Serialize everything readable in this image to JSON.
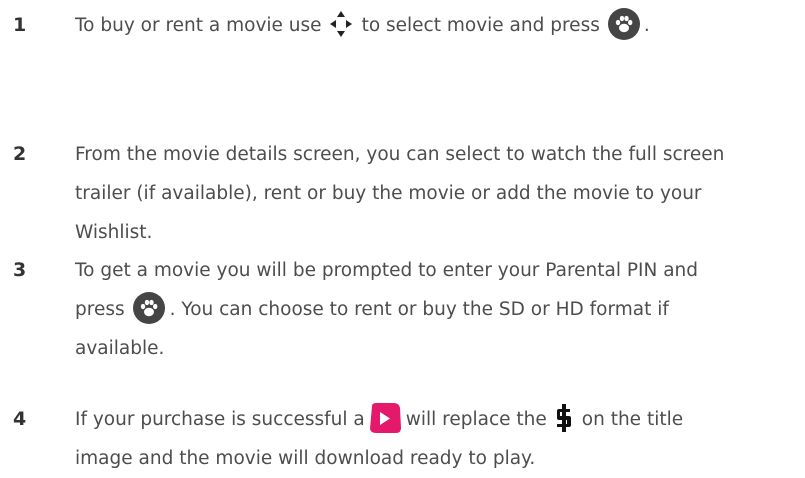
{
  "steps": [
    {
      "number": "1",
      "pre": "To buy or rent a movie use",
      "mid": "to select movie and press",
      "end": "."
    },
    {
      "number": "2",
      "line1": "From the movie details screen, you can select to watch the full screen",
      "line2": "trailer (if available), rent or buy the movie or add the movie to your",
      "line3": "Wishlist."
    },
    {
      "number": "3",
      "line1": "To get a movie you will be prompted to enter your Parental PIN and",
      "press": "press",
      "after": ". You can choose to rent or buy the SD or HD format if",
      "line3": "available."
    },
    {
      "number": "4",
      "pre": "If your purchase is successful a",
      "mid": "will replace the",
      "post": "on the title",
      "line2": "image and the movie will download ready to play."
    }
  ],
  "icons": {
    "dpad": "dpad-arrows-icon",
    "ok": "paw-button-icon",
    "purchased": "play-badge-icon",
    "price": "dollar-icon"
  },
  "colors": {
    "text": "#4d4d4d",
    "number": "#333333",
    "paw_button": "#454545",
    "play_badge": "#e5196b"
  }
}
